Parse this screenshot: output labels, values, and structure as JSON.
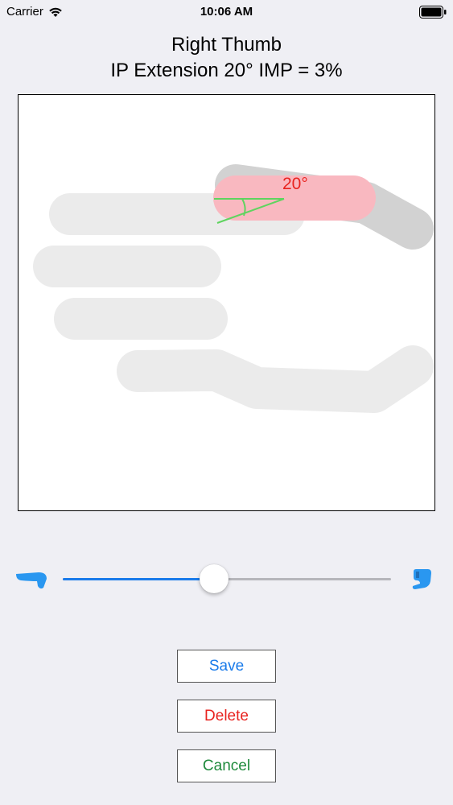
{
  "status_bar": {
    "carrier": "Carrier",
    "time": "10:06 AM"
  },
  "header": {
    "line1": "Right Thumb",
    "line2": "IP Extension 20° IMP = 3%"
  },
  "diagram": {
    "angle_label": "20°",
    "angle_color": "#e8231f",
    "measure_line_color": "#5fd45f",
    "highlight_color": "#f9b8c0"
  },
  "slider": {
    "value": 0.46,
    "accent_color": "#1a7bea",
    "min_icon": "thumb-extended-icon",
    "max_icon": "thumb-flexed-icon"
  },
  "buttons": {
    "save": "Save",
    "delete": "Delete",
    "cancel": "Cancel",
    "save_color": "#1a7bea",
    "delete_color": "#e8231f",
    "cancel_color": "#1f8a3c"
  }
}
